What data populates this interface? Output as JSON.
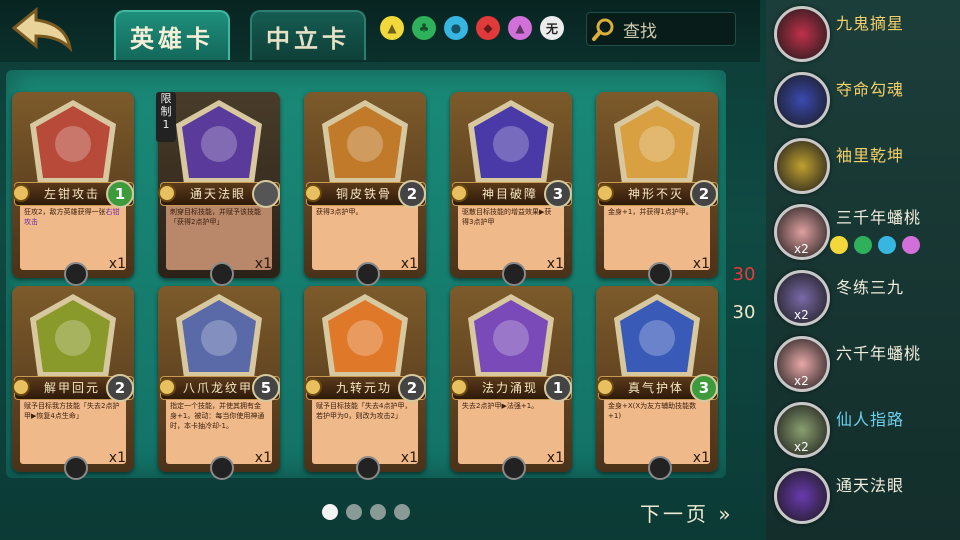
{
  "tabs": {
    "hero": "英雄卡",
    "neutral": "中立卡"
  },
  "search": {
    "placeholder": "查找"
  },
  "element_filters": [
    {
      "icon": "triangle-icon",
      "color": "#f2d83a"
    },
    {
      "icon": "tree-icon",
      "color": "#2fb05a"
    },
    {
      "icon": "water-drop-icon",
      "color": "#36b6e0"
    },
    {
      "icon": "fire-icon",
      "color": "#e03a3a"
    },
    {
      "icon": "mountain-icon",
      "color": "#d070d8"
    },
    {
      "icon": "none-icon",
      "color": "#ececec",
      "label": "无"
    }
  ],
  "cards": [
    {
      "name": "左钳攻击",
      "cost": "1",
      "cost_color": "#3d9b3d",
      "count": "x1",
      "desc": "狂攻2，敌方英雄获得一张",
      "desc_link": "右钳攻击",
      "art_color": "#b84a3a",
      "dim": false
    },
    {
      "name": "通天法眼",
      "cost": "",
      "cost_color": "#555555",
      "count": "x1",
      "desc": "刺穿目标技能，并赋予该技能「获得2点护甲」",
      "art_color": "#5a3a9a",
      "dim": true,
      "limit": "限制 1"
    },
    {
      "name": "铜皮铁骨",
      "cost": "2",
      "cost_color": "#444444",
      "count": "x1",
      "desc": "获得3点护甲。",
      "art_color": "#c07a2a",
      "dim": false
    },
    {
      "name": "神目破障",
      "cost": "3",
      "cost_color": "#444444",
      "count": "x1",
      "desc": "驱散目标技能的增益效果▶获得3点护甲",
      "art_color": "#4a3aa8",
      "dim": false
    },
    {
      "name": "神形不灭",
      "cost": "2",
      "cost_color": "#444444",
      "count": "x1",
      "desc": "金身+1，并获得1点护甲。",
      "art_color": "#d8a040",
      "dim": false
    },
    {
      "name": "解甲回元",
      "cost": "2",
      "cost_color": "#444444",
      "count": "x1",
      "desc": "赋予目标我方技能「失去2点护甲▶恢复4点生命」",
      "art_color": "#8a9a2a",
      "dim": false
    },
    {
      "name": "八爪龙纹甲",
      "cost": "5",
      "cost_color": "#444444",
      "count": "x1",
      "desc": "指定一个技能，并使其拥有金身+1。被动：每当你使用神通时，本卡抽冷却-1。",
      "art_color": "#5a6aa8",
      "dim": false
    },
    {
      "name": "九转元功",
      "cost": "2",
      "cost_color": "#444444",
      "count": "x1",
      "desc": "赋予目标技能「失去4点护甲，若护甲为0，则改为攻击2」",
      "art_color": "#e0782a",
      "dim": false
    },
    {
      "name": "法力涌现",
      "cost": "1",
      "cost_color": "#444444",
      "count": "x1",
      "desc": "失去2点护甲▶法强+1。",
      "art_color": "#7a4ab8",
      "dim": false
    },
    {
      "name": "真气护体",
      "cost": "3",
      "cost_color": "#3d9b3d",
      "count": "x1",
      "desc": "金身+X(X为友方辅助技能数+1)",
      "art_color": "#3a5ab8",
      "dim": false
    }
  ],
  "pagination": {
    "pages": 4,
    "current": 1,
    "next_label": "下一页"
  },
  "counters": {
    "limit_value": "30",
    "current_value": "30"
  },
  "deck_list": [
    {
      "name": "九鬼摘星",
      "count": "",
      "color": "#c0304a",
      "label_color": "gold"
    },
    {
      "name": "夺命勾魂",
      "count": "",
      "color": "#3a4ab0",
      "label_color": "gold"
    },
    {
      "name": "袖里乾坤",
      "count": "",
      "color": "#c0a030",
      "label_color": "gold"
    },
    {
      "name": "三千年蟠桃",
      "count": "x2",
      "color": "#e0a0a0",
      "label_color": "white",
      "elements": [
        "#f2d83a",
        "#2fb05a",
        "#36b6e0",
        "#d070d8"
      ]
    },
    {
      "name": "冬练三九",
      "count": "x2",
      "color": "#7a6aa8",
      "label_color": "white"
    },
    {
      "name": "六千年蟠桃",
      "count": "x2",
      "color": "#e8a8a8",
      "label_color": "white"
    },
    {
      "name": "仙人指路",
      "count": "x2",
      "color": "#8aa070",
      "label_color": "blue"
    },
    {
      "name": "通天法眼",
      "count": "",
      "color": "#6a3ab0",
      "label_color": "white"
    }
  ]
}
